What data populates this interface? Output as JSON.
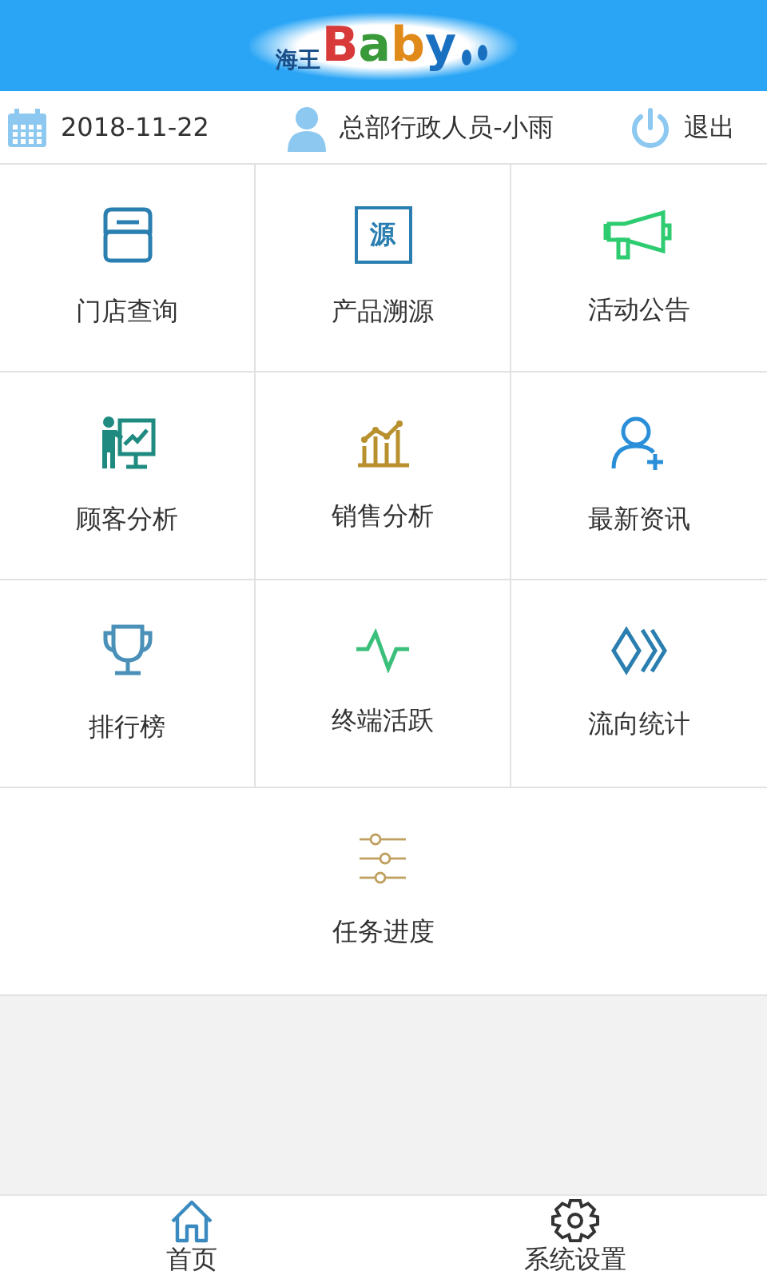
{
  "header": {
    "logo": {
      "prefix": "海王",
      "letters": [
        {
          "text": "B",
          "color": "#d83a3a"
        },
        {
          "text": "a",
          "color": "#3a9a3a"
        },
        {
          "text": "b",
          "color": "#e08a1a"
        },
        {
          "text": "y",
          "color": "#1a70c0"
        }
      ]
    }
  },
  "info_bar": {
    "date": "2018-11-22",
    "user": "总部行政人员-小雨",
    "logout": "退出"
  },
  "tiles": [
    {
      "label": "门店查询",
      "kind": "store",
      "color": "#2a7fb0"
    },
    {
      "label": "产品溯源",
      "kind": "source",
      "color": "#2a7fb0",
      "glyph": "源"
    },
    {
      "label": "活动公告",
      "kind": "megaphone",
      "color": "#2ecc71"
    },
    {
      "label": "顾客分析",
      "kind": "presenter",
      "color": "#1f8a80"
    },
    {
      "label": "销售分析",
      "kind": "barchart",
      "color": "#b8902e"
    },
    {
      "label": "最新资讯",
      "kind": "useradd",
      "color": "#2a8fd8"
    },
    {
      "label": "排行榜",
      "kind": "trophy",
      "color": "#4a90b8"
    },
    {
      "label": "终端活跃",
      "kind": "pulse",
      "color": "#3ac07a"
    },
    {
      "label": "流向统计",
      "kind": "chevrons",
      "color": "#2a7fb0"
    },
    {
      "label": "任务进度",
      "kind": "sliders",
      "color": "#c0a060"
    }
  ],
  "bottom_nav": [
    {
      "label": "首页",
      "kind": "home",
      "selected": true
    },
    {
      "label": "系统设置",
      "kind": "gear",
      "selected": false
    }
  ]
}
